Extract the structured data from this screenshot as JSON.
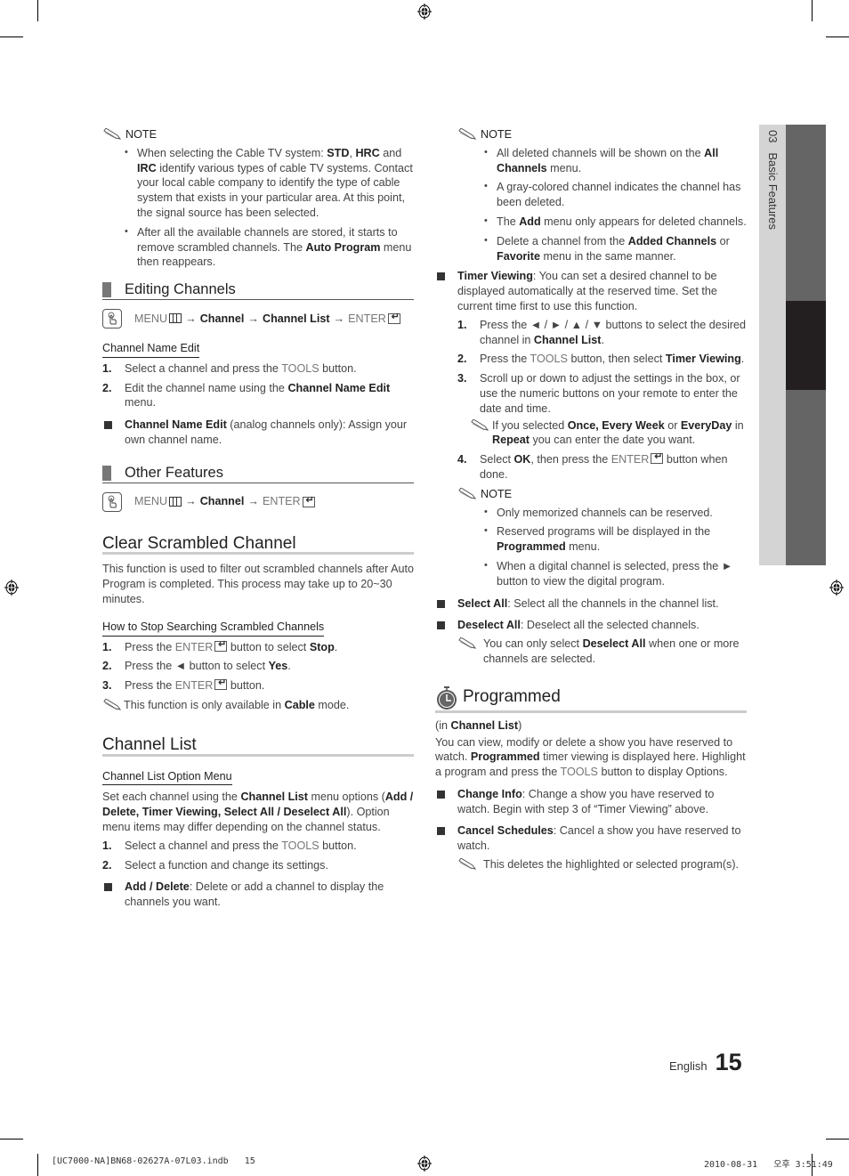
{
  "left_column": {
    "note1": {
      "label": "NOTE",
      "bullets": [
        [
          "When selecting the Cable TV system: ",
          {
            "b": "STD"
          },
          ", ",
          {
            "b": "HRC"
          },
          " and ",
          {
            "b": "IRC"
          },
          " identify various types of cable TV systems. Contact your local cable company to identify the type of cable system that exists in your particular area. At this point, the signal source has been selected."
        ],
        [
          "After all the available channels are stored, it starts to remove scrambled channels. The ",
          {
            "b": "Auto Program"
          },
          " menu then reappears."
        ]
      ]
    },
    "editing_channels": {
      "title": "Editing Channels",
      "path": {
        "menu": "MENU",
        "arrow": "→",
        "items": [
          "Channel",
          "Channel List"
        ],
        "enter": "ENTER"
      },
      "subsection_title": "Channel Name Edit",
      "steps": [
        [
          "Select a channel and press the ",
          {
            "g": "TOOLS"
          },
          " button."
        ],
        [
          "Edit the channel name using the ",
          {
            "b": "Channel Name Edit"
          },
          " menu."
        ]
      ],
      "square_item": [
        {
          "b": "Channel Name Edit"
        },
        " (analog channels only): Assign your own channel name."
      ]
    },
    "other_features": {
      "title": "Other Features",
      "path": {
        "menu": "MENU",
        "arrow": "→",
        "items": [
          "Channel"
        ],
        "enter": "ENTER"
      }
    },
    "clear_scrambled": {
      "title": "Clear Scrambled Channel",
      "body": "This function is used to filter out scrambled channels after Auto Program is completed. This process may take up to 20~30 minutes.",
      "subsection_title": "How to Stop Searching Scrambled Channels",
      "steps": [
        [
          "Press the ",
          {
            "g": "ENTER"
          },
          {
            "enter": true
          },
          " button to select ",
          {
            "b": "Stop"
          },
          "."
        ],
        [
          "Press the ◄ button to select ",
          {
            "b": "Yes"
          },
          "."
        ],
        [
          "Press the ",
          {
            "g": "ENTER"
          },
          {
            "enter": true
          },
          " button."
        ]
      ],
      "note": [
        "This function is only available in ",
        {
          "b": "Cable"
        },
        " mode."
      ]
    },
    "channel_list": {
      "title": "Channel List",
      "subsection_title": "Channel List Option Menu",
      "body": [
        "Set each channel using the ",
        {
          "b": "Channel List"
        },
        " menu options (",
        {
          "b": "Add / Delete, Timer Viewing, Select All / Deselect All"
        },
        "). Option menu items may differ depending on the channel status."
      ],
      "steps": [
        [
          "Select a channel and press the ",
          {
            "g": "TOOLS"
          },
          " button."
        ],
        [
          "Select a function and change its settings."
        ]
      ],
      "square_item": [
        {
          "b": "Add / Delete"
        },
        ": Delete or add a channel to display the channels you want."
      ]
    }
  },
  "right_column": {
    "note1": {
      "label": "NOTE",
      "bullets": [
        [
          "All deleted channels will be shown on the ",
          {
            "b": "All Channels"
          },
          " menu."
        ],
        [
          "A gray-colored channel indicates the channel has been deleted."
        ],
        [
          "The ",
          {
            "b": "Add"
          },
          " menu only appears for deleted channels."
        ],
        [
          "Delete a channel from the ",
          {
            "b": "Added Channels"
          },
          " or ",
          {
            "b": "Favorite"
          },
          " menu in the same manner."
        ]
      ]
    },
    "timer_viewing": {
      "intro": [
        {
          "b": "Timer Viewing"
        },
        ": You can set a desired channel to be displayed automatically at the reserved time. Set the current time first to use this function."
      ],
      "steps": [
        [
          "Press the ◄ / ► / ▲ / ▼ buttons to select the desired channel in ",
          {
            "b": "Channel List"
          },
          "."
        ],
        [
          "Press the ",
          {
            "g": "TOOLS"
          },
          " button, then select ",
          {
            "b": "Timer Viewing"
          },
          "."
        ],
        [
          "Scroll up or down to adjust the settings in the box, or use the numeric buttons on your remote to enter the date and time."
        ],
        [
          "Select ",
          {
            "b": "OK"
          },
          ", then press the ",
          {
            "g": "ENTER"
          },
          {
            "enter": true
          },
          " button when done."
        ]
      ],
      "step3_note": [
        "If you selected ",
        {
          "b": "Once, Every Week"
        },
        " or ",
        {
          "b": "EveryDay"
        },
        " in ",
        {
          "b": "Repeat"
        },
        " you can enter the date you want."
      ],
      "note2": {
        "label": "NOTE",
        "bullets": [
          [
            "Only memorized channels can be reserved."
          ],
          [
            "Reserved programs will be displayed in the ",
            {
              "b": "Programmed"
            },
            " menu."
          ],
          [
            "When a digital channel is selected, press the ► button to view the digital program."
          ]
        ]
      }
    },
    "select_all": [
      {
        "b": "Select All"
      },
      ": Select all the channels in the channel list."
    ],
    "deselect_all": [
      {
        "b": "Deselect All"
      },
      ": Deselect all the selected channels."
    ],
    "deselect_note": [
      "You can only select ",
      {
        "b": "Deselect All"
      },
      " when one or more channels are selected."
    ],
    "programmed": {
      "title": "Programmed",
      "context": [
        "(in ",
        {
          "b": "Channel List"
        },
        ")"
      ],
      "body": [
        "You can view, modify or delete a show you have reserved to watch. ",
        {
          "b": "Programmed"
        },
        " timer viewing is displayed here. Highlight a program and press the ",
        {
          "g": "TOOLS"
        },
        " button to display Options."
      ],
      "items": [
        [
          {
            "b": "Change Info"
          },
          ": Change a show you have reserved to watch. Begin with step 3 of “Timer Viewing” above."
        ],
        [
          {
            "b": "Cancel Schedules"
          },
          ": Cancel a show you have reserved to watch."
        ]
      ],
      "note": [
        "This deletes the highlighted or selected program(s)."
      ]
    }
  },
  "side_tab": {
    "chapter": "03",
    "title": "Basic Features",
    "colors": {
      "light": "#d4d4d4",
      "mid": "#666565",
      "dark": "#231f20"
    }
  },
  "footer": {
    "language": "English",
    "page_number": "15",
    "file_slug": "[UC7000-NA]BN68-02627A-07L03.indb   15",
    "timestamp": "2010-08-31   오후 3:51:49"
  }
}
